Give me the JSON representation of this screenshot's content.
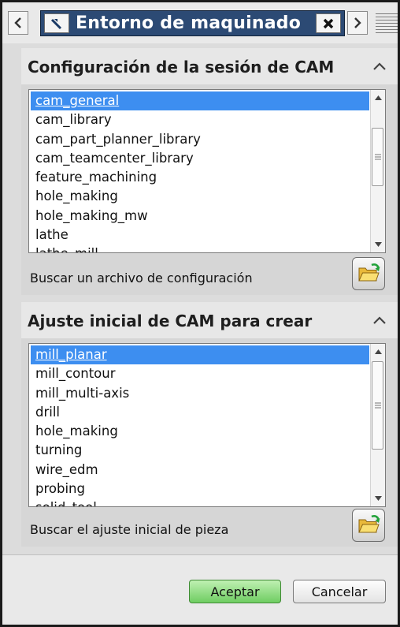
{
  "window": {
    "title": "Entorno de maquinado",
    "nav_prev_glyph": "<",
    "nav_next_glyph": ">",
    "pin_icon": "pin-icon",
    "close_icon": "close-icon",
    "tab_color": "#2c4a74"
  },
  "session_config": {
    "title": "Configuración de la sesión de CAM",
    "items": [
      "cam_general",
      "cam_library",
      "cam_part_planner_library",
      "cam_teamcenter_library",
      "feature_machining",
      "hole_making",
      "hole_making_mw",
      "lathe",
      "lathe_mill"
    ],
    "selected": "cam_general",
    "browse_label": "Buscar un archivo de configuración"
  },
  "cam_setup": {
    "title": "Ajuste inicial de CAM para crear",
    "items": [
      "mill_planar",
      "mill_contour",
      "mill_multi-axis",
      "drill",
      "hole_making",
      "turning",
      "wire_edm",
      "probing",
      "solid_tool"
    ],
    "selected": "mill_planar",
    "browse_label": "Buscar el ajuste inicial de pieza"
  },
  "footer": {
    "ok_label": "Aceptar",
    "cancel_label": "Cancelar",
    "ok_color": "#6fcd62"
  }
}
